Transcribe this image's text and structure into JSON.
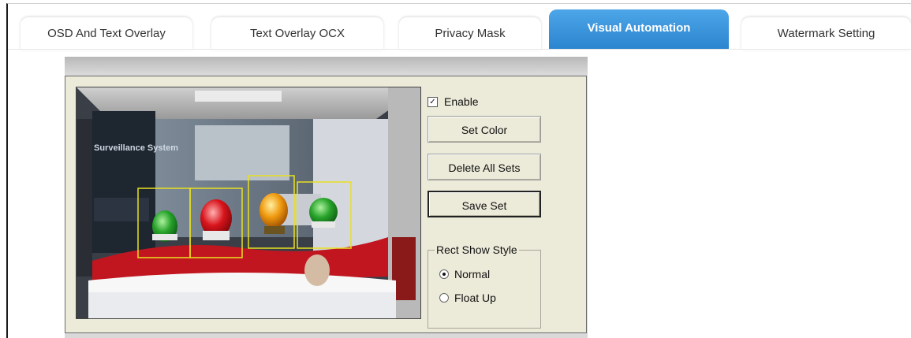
{
  "tabs": [
    {
      "label": "OSD And Text Overlay",
      "active": false
    },
    {
      "label": "Text Overlay OCX",
      "active": false
    },
    {
      "label": "Privacy Mask",
      "active": false
    },
    {
      "label": "Visual Automation",
      "active": true
    },
    {
      "label": "Watermark Setting",
      "active": false
    }
  ],
  "camera": {
    "poster_text": "Surveillance System",
    "detected_object_colors": [
      "green",
      "red",
      "orange",
      "green"
    ]
  },
  "controls": {
    "enable_label": "Enable",
    "enable_checked": true,
    "set_color_label": "Set Color",
    "delete_all_label": "Delete All Sets",
    "save_set_label": "Save Set",
    "rect_style_title": "Rect Show Style",
    "normal_label": "Normal",
    "float_up_label": "Float Up",
    "selected_style": "Normal"
  },
  "colors": {
    "accent": "#2b85cf",
    "dialog_bg": "#ecead9",
    "detection_box": "#e8e020"
  }
}
